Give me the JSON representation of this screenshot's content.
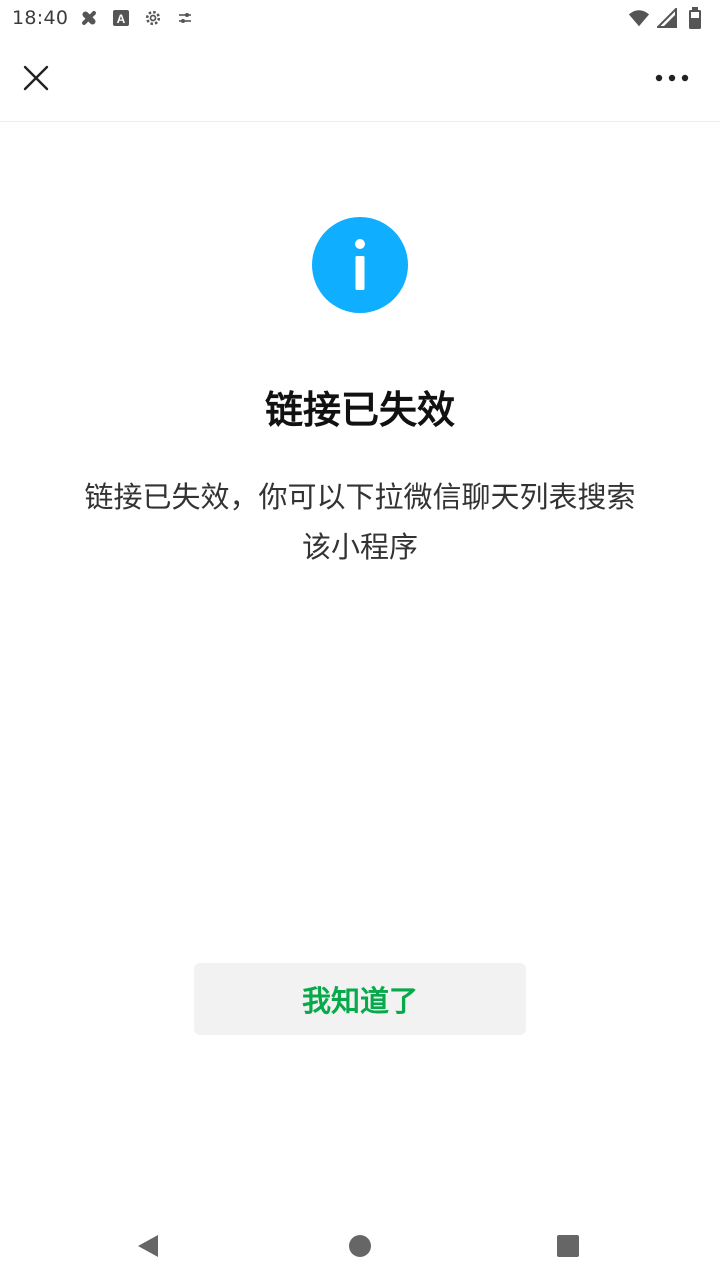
{
  "status_bar": {
    "time": "18:40",
    "icons": [
      "bluetooth-off-icon",
      "a-box-icon",
      "gear-icon",
      "tune-icon",
      "wifi-icon",
      "signal-icon",
      "battery-icon"
    ]
  },
  "nav_bar": {
    "close_icon": "close-icon",
    "more_icon": "more-icon"
  },
  "content": {
    "info_icon_color": "#10aeff",
    "title": "链接已失效",
    "description_line1": "链接已失效，你可以下拉微信聊天列表搜索",
    "description_line2": "该小程序"
  },
  "actions": {
    "ok_label": "我知道了",
    "ok_color": "#07a94a"
  },
  "system_nav": {
    "back": "back-icon",
    "home": "home-icon",
    "recents": "recents-icon"
  }
}
